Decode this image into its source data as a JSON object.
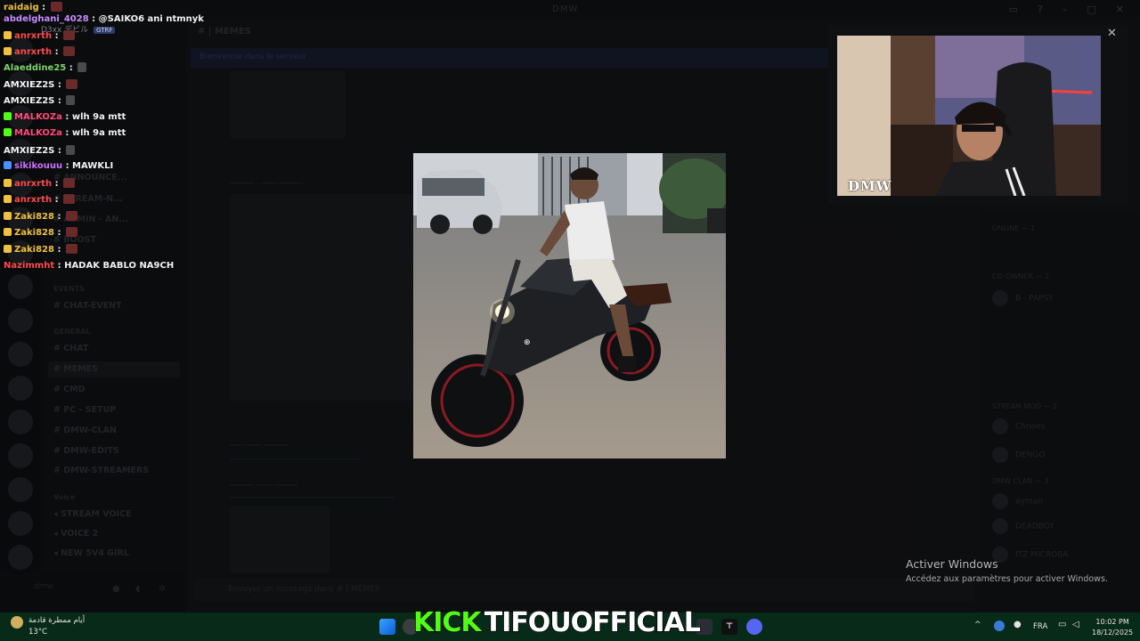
{
  "discord": {
    "window_title": "DMW",
    "channel_title": "| MEMES",
    "banner_text": "Bienvenue dans le serveur",
    "channels": [
      {
        "label": "ANNOUNCE...",
        "kind": "channel"
      },
      {
        "label": "STREAM-N...",
        "kind": "channel"
      },
      {
        "label": "ADMIN - AN...",
        "kind": "channel"
      },
      {
        "label": "BOOST",
        "kind": "channel"
      },
      {
        "label": "EVENTS",
        "kind": "category"
      },
      {
        "label": "CHAT-EVENT",
        "kind": "channel"
      },
      {
        "label": "GENERAL",
        "kind": "category"
      },
      {
        "label": "CHAT",
        "kind": "channel"
      },
      {
        "label": "MEMES",
        "kind": "channel"
      },
      {
        "label": "CMD",
        "kind": "channel"
      },
      {
        "label": "PC - SETUP",
        "kind": "channel"
      },
      {
        "label": "DMW-CLAN",
        "kind": "channel"
      },
      {
        "label": "DMW-EDITS",
        "kind": "channel"
      },
      {
        "label": "DMW-STREAMERS",
        "kind": "channel"
      },
      {
        "label": "Voice",
        "kind": "category"
      },
      {
        "label": "STREAM VOICE",
        "kind": "channel"
      },
      {
        "label": "VOICE 2",
        "kind": "channel"
      },
      {
        "label": "NEW 5V4 GIRL",
        "kind": "channel"
      }
    ],
    "composer_placeholder": "Envoyer un message dans # | MEMES",
    "members": [
      {
        "section": "ONLINE — 1"
      },
      {
        "section": "CO-OWNER — 2"
      },
      {
        "name": "B - PAPSY"
      },
      {
        "section": "STREAM MOD — 2"
      },
      {
        "name": "Chnoes"
      },
      {
        "name": "DENGO"
      },
      {
        "section": "DMW CLAN — 3"
      },
      {
        "name": "ayman"
      },
      {
        "name": "DEADBOY"
      },
      {
        "name": "ITZ MICROBA"
      }
    ],
    "user_panel_name": "dmw"
  },
  "stream_chat": [
    {
      "user": "raidaig",
      "color": "#f0c040",
      "text": "",
      "emote": true,
      "badge": ""
    },
    {
      "user": "abdelghani_4028",
      "color": "#c68cff",
      "text": "@SAIKO6 ani ntmnyk",
      "emote": false,
      "badge": ""
    },
    {
      "user": "anrxrth",
      "color": "#ff4a4a",
      "text": "",
      "emote": true,
      "badge": "#f0c040"
    },
    {
      "user": "anrxrth",
      "color": "#ff4a4a",
      "text": "",
      "emote": true,
      "badge": "#f0c040"
    },
    {
      "user": "Alaeddine25",
      "color": "#7fd36a",
      "text": "",
      "emote": true,
      "badge": ""
    },
    {
      "user": "AMXIEZ2S",
      "color": "#f2f2f2",
      "text": "",
      "emote": true,
      "badge": ""
    },
    {
      "user": "AMXIEZ2S",
      "color": "#f2f2f2",
      "text": "",
      "emote": true,
      "badge": ""
    },
    {
      "user": "MALKOZa",
      "color": "#ff4a7a",
      "text": "wlh 9a mtt",
      "emote": false,
      "badge": "#53fc18"
    },
    {
      "user": "MALKOZa",
      "color": "#ff4a7a",
      "text": "wlh 9a mtt",
      "emote": false,
      "badge": "#53fc18"
    },
    {
      "user": "AMXIEZ2S",
      "color": "#f2f2f2",
      "text": "",
      "emote": true,
      "badge": ""
    },
    {
      "user": "sikikouuu",
      "color": "#d070ff",
      "text": "MAWKLI",
      "emote": false,
      "badge": "#4a90ff"
    },
    {
      "user": "anrxrth",
      "color": "#ff4a4a",
      "text": "",
      "emote": true,
      "badge": "#f0c040"
    },
    {
      "user": "anrxrth",
      "color": "#ff4a4a",
      "text": "",
      "emote": true,
      "badge": "#f0c040"
    },
    {
      "user": "Zaki828",
      "color": "#f0c040",
      "text": "",
      "emote": true,
      "badge": "#f0c040"
    },
    {
      "user": "Zaki828",
      "color": "#f0c040",
      "text": "",
      "emote": true,
      "badge": "#f0c040"
    },
    {
      "user": "Zaki828",
      "color": "#f0c040",
      "text": "",
      "emote": true,
      "badge": "#f0c040"
    },
    {
      "user": "Nazimmht",
      "color": "#ff4a4a",
      "text": "HADAK BABLO NA9CH",
      "emote": false,
      "badge": ""
    }
  ],
  "chat_separator": ":",
  "overlay_name": "D3xx デビル",
  "overlay_tag": "GTRF",
  "webcam": {
    "tag": "DMW",
    "close": "✕"
  },
  "activate_windows": {
    "heading": "Activer Windows",
    "subtext": "Accédez aux paramètres pour activer Windows."
  },
  "stream_branding": {
    "platform": "KICK",
    "channel": "TIFOUOFFICIAL"
  },
  "taskbar": {
    "weather_desc": "أيام ممطرة قادمة",
    "temperature": "13°C",
    "language": "FRA",
    "time": "10:02 PM",
    "date": "18/12/2025",
    "chevron": "^"
  },
  "colors": {
    "kick_green": "#53fc18",
    "taskbar": "#082a18",
    "discord_bg": "#151618"
  }
}
